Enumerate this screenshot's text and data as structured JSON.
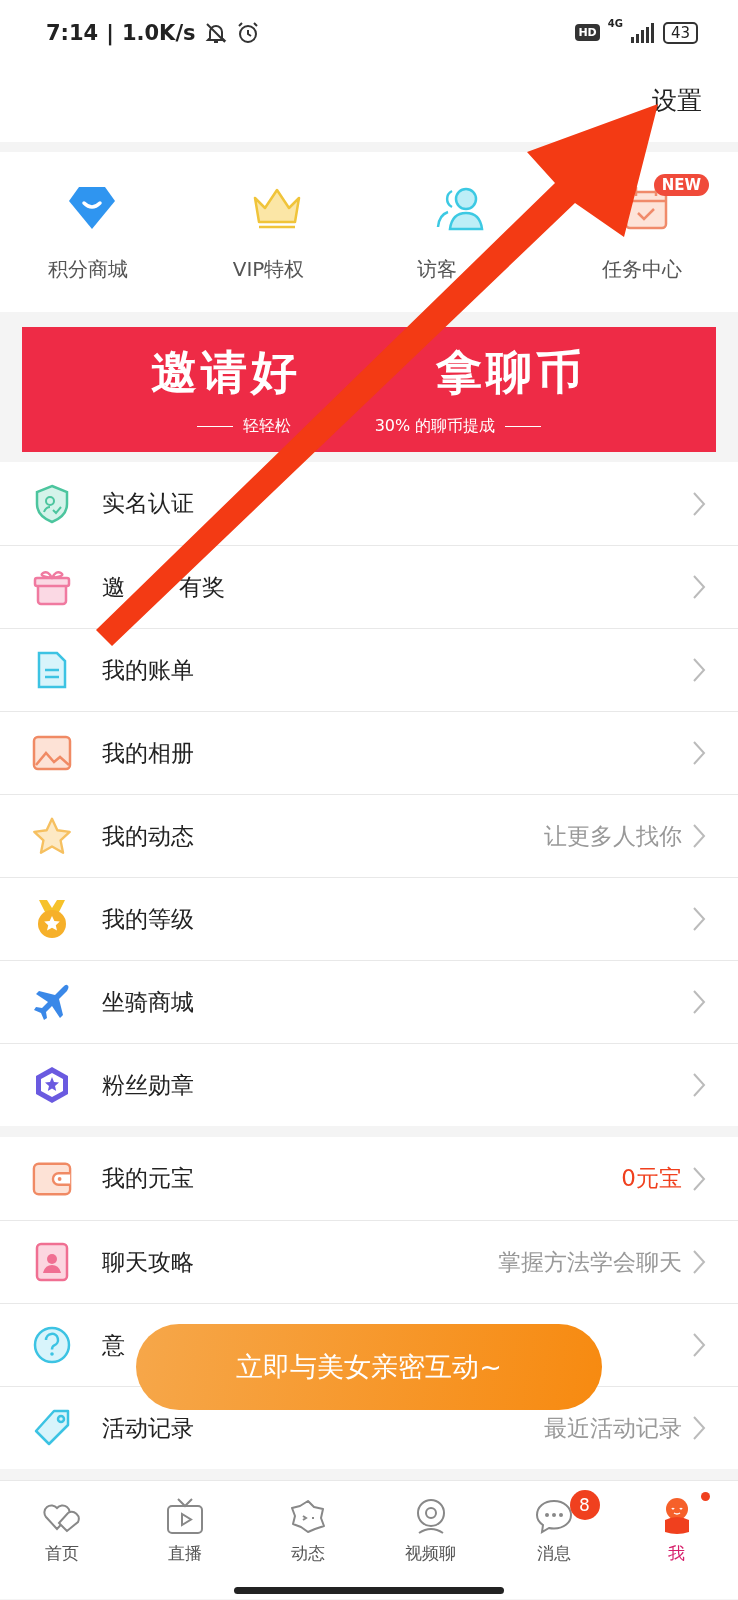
{
  "status_bar": {
    "time": "7:14",
    "separator": "|",
    "speed": "1.0K/s",
    "hd": "HD",
    "network": "4G",
    "battery": "43"
  },
  "header": {
    "settings": "设置"
  },
  "shortcuts": [
    {
      "label": "积分商城"
    },
    {
      "label": "VIP特权"
    },
    {
      "label": "访客"
    },
    {
      "label": "任务中心",
      "badge": "NEW"
    }
  ],
  "banner": {
    "title_parts": [
      "邀请好",
      "拿聊币"
    ],
    "subtitle_parts": [
      "轻轻松",
      "30% 的聊币提成"
    ]
  },
  "groups": [
    {
      "rows": [
        {
          "label_parts": [
            "实名认证"
          ]
        },
        {
          "label_parts": [
            "邀",
            "有奖"
          ]
        },
        {
          "label_parts": [
            "我的账单"
          ]
        },
        {
          "label_parts": [
            "我的相册"
          ]
        },
        {
          "label_parts": [
            "我的动态"
          ],
          "hint": "让更多人找你",
          "color": "#999999"
        },
        {
          "label_parts": [
            "我的等级"
          ]
        },
        {
          "label_parts": [
            "坐骑商城"
          ]
        },
        {
          "label_parts": [
            "粉丝勋章"
          ]
        }
      ]
    },
    {
      "rows": [
        {
          "label_parts": [
            "我的元宝"
          ],
          "hint": "0元宝",
          "color": "#f0401e"
        },
        {
          "label_parts": [
            "聊天攻略"
          ],
          "hint": "掌握方法学会聊天",
          "color": "#999999"
        },
        {
          "label_parts": [
            "意"
          ]
        },
        {
          "label_parts": [
            "活动记录"
          ],
          "hint": "最近活动记录",
          "color": "#999999"
        }
      ]
    }
  ],
  "float_button": {
    "label": "立即与美女亲密互动~"
  },
  "nav": [
    {
      "label": "首页",
      "selected": false,
      "dot": false
    },
    {
      "label": "直播",
      "selected": false,
      "dot": false
    },
    {
      "label": "动态",
      "selected": false,
      "dot": false
    },
    {
      "label": "视频聊",
      "selected": false,
      "dot": false
    },
    {
      "label": "消息",
      "selected": false,
      "badge": "8",
      "dot": false
    },
    {
      "label": "我",
      "selected": true,
      "dot": true
    }
  ]
}
